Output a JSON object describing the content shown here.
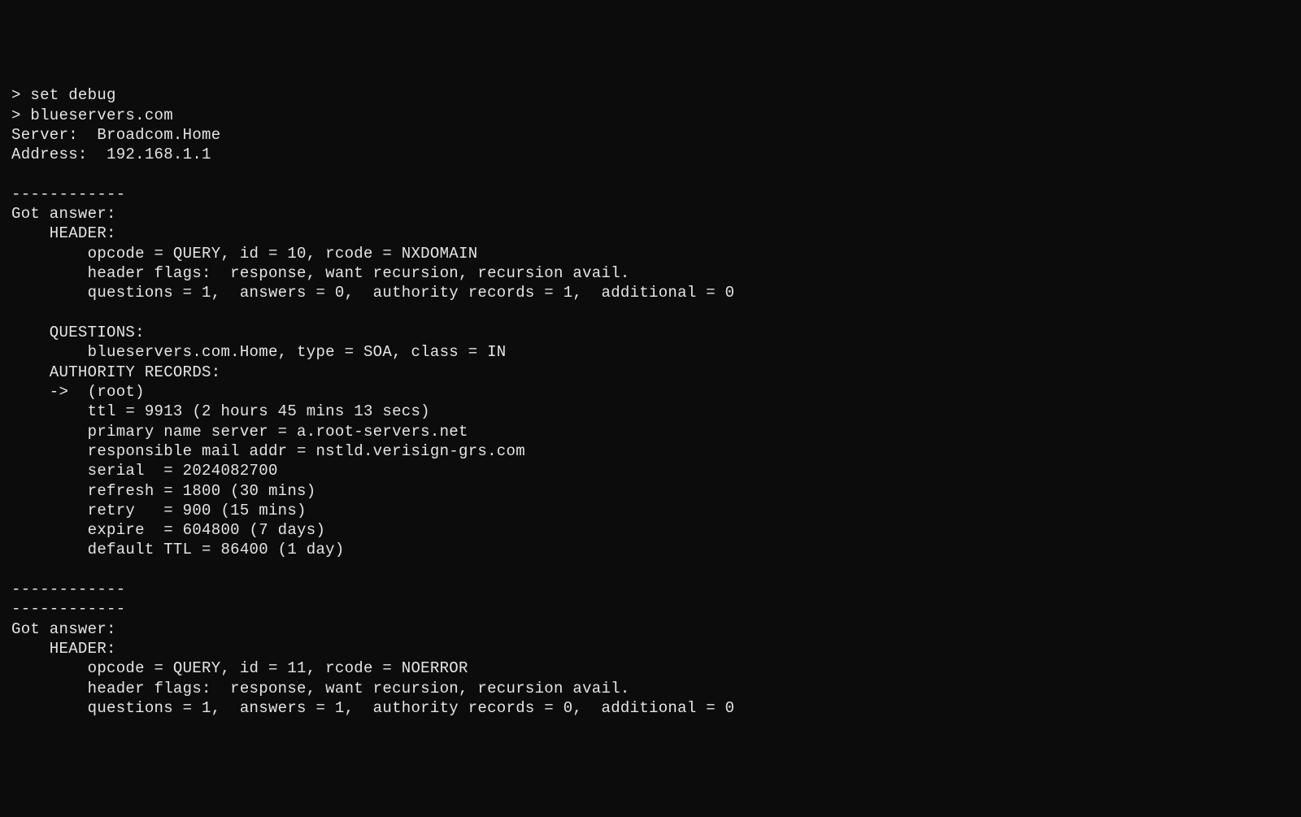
{
  "terminal": {
    "lines": [
      "> set debug",
      "> blueservers.com",
      "Server:  Broadcom.Home",
      "Address:  192.168.1.1",
      "",
      "------------",
      "Got answer:",
      "    HEADER:",
      "        opcode = QUERY, id = 10, rcode = NXDOMAIN",
      "        header flags:  response, want recursion, recursion avail.",
      "        questions = 1,  answers = 0,  authority records = 1,  additional = 0",
      "",
      "    QUESTIONS:",
      "        blueservers.com.Home, type = SOA, class = IN",
      "    AUTHORITY RECORDS:",
      "    ->  (root)",
      "        ttl = 9913 (2 hours 45 mins 13 secs)",
      "        primary name server = a.root-servers.net",
      "        responsible mail addr = nstld.verisign-grs.com",
      "        serial  = 2024082700",
      "        refresh = 1800 (30 mins)",
      "        retry   = 900 (15 mins)",
      "        expire  = 604800 (7 days)",
      "        default TTL = 86400 (1 day)",
      "",
      "------------",
      "------------",
      "Got answer:",
      "    HEADER:",
      "        opcode = QUERY, id = 11, rcode = NOERROR",
      "        header flags:  response, want recursion, recursion avail.",
      "        questions = 1,  answers = 1,  authority records = 0,  additional = 0"
    ]
  }
}
